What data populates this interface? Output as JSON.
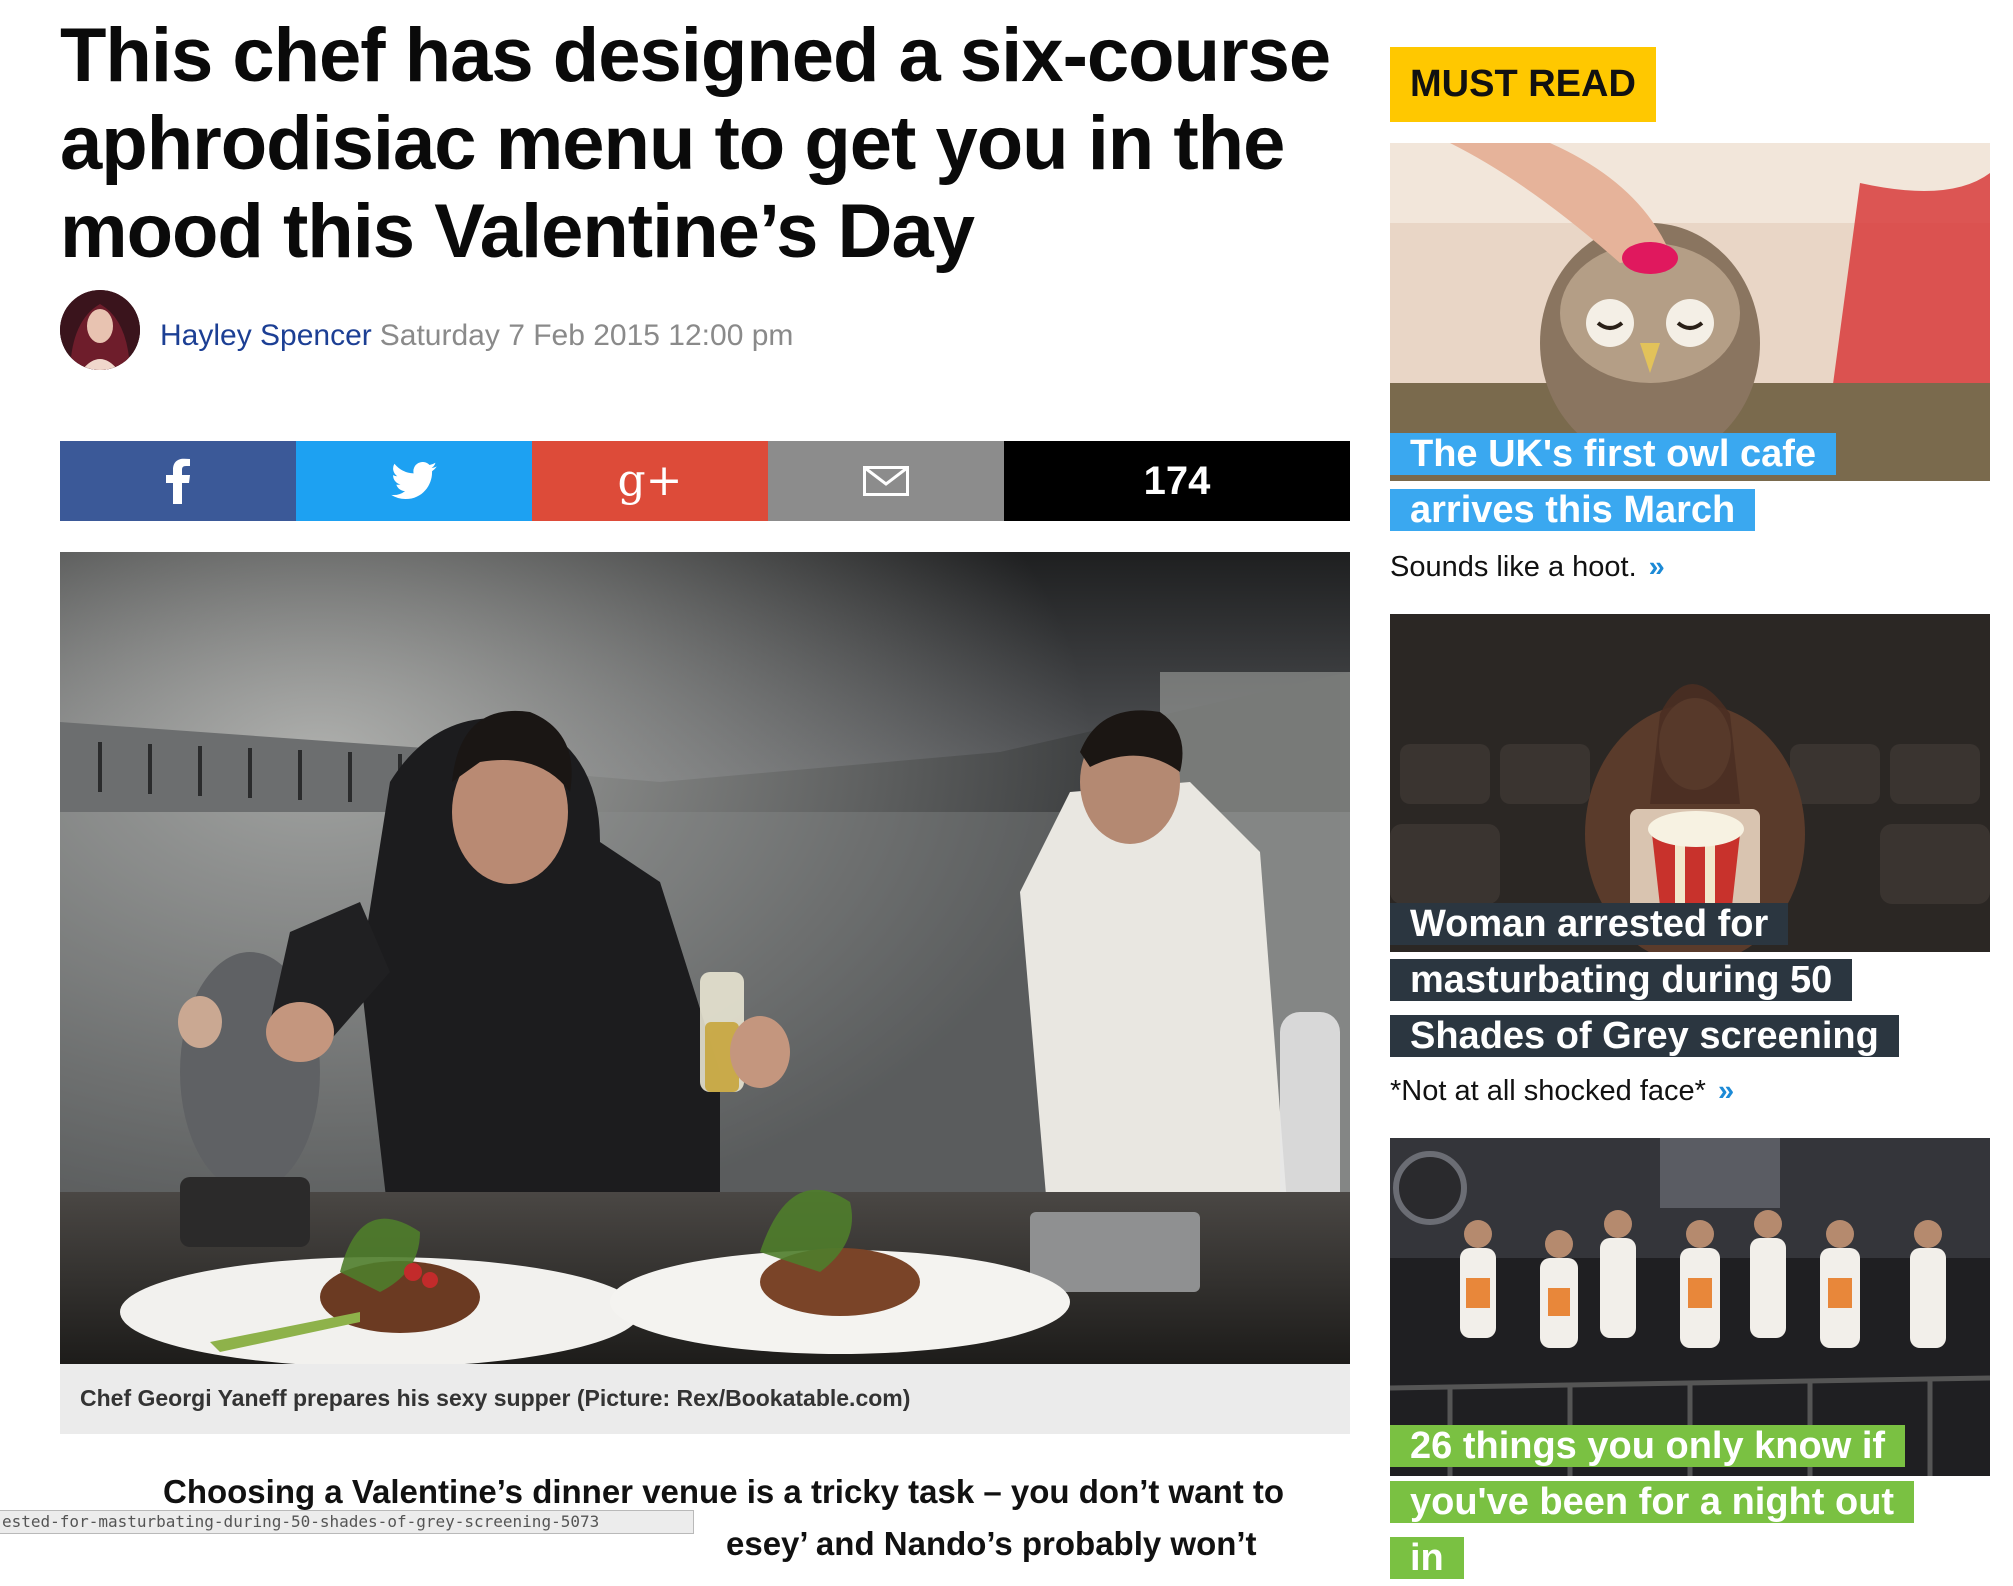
{
  "article": {
    "headline": "This chef has designed a six-course aphrodisiac menu to get you in the mood this Valentine’s Day",
    "author": "Hayley Spencer",
    "date": "Saturday 7 Feb 2015 12:00 pm",
    "share": {
      "facebook_icon": "facebook-icon",
      "twitter_icon": "twitter-icon",
      "google_plus_label": "g+",
      "email_icon": "email-icon",
      "count": "174"
    },
    "hero_caption": "Chef Georgi Yaneff prepares his sexy supper (Picture: Rex/Bookatable.com)",
    "body_first_line": "Choosing a Valentine’s dinner venue is a tricky task – you don’t want to",
    "body_second_line_fragment": "esey’ and Nando’s probably won’t"
  },
  "status_bar_url": "ested-for-masturbating-during-50-shades-of-grey-screening-5073",
  "sidebar": {
    "heading": "MUST READ",
    "cards": [
      {
        "title": "The UK's first owl cafe arrives this March",
        "subtitle": "Sounds like a hoot.",
        "more": "»",
        "title_bg": "#3aa8f0"
      },
      {
        "title": "Woman arrested for masturbating during 50 Shades of Grey screening",
        "subtitle": "*Not at all shocked face*",
        "more": "»",
        "title_bg": "#2b3640"
      },
      {
        "title": "26 things you only know if you've been for a night out in",
        "title_bg": "#7ac142"
      }
    ]
  },
  "colors": {
    "facebook": "#3b5998",
    "twitter": "#1da1f2",
    "google_plus": "#dd4b39",
    "email": "#8c8c8c",
    "count_bg": "#000000",
    "must_read_bg": "#ffc800",
    "author_link": "#1c3f94"
  }
}
